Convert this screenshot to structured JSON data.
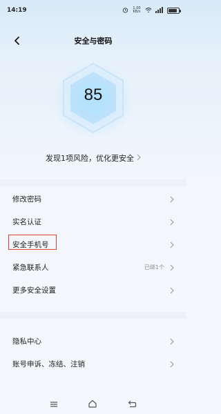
{
  "status_bar": {
    "time": "14:19",
    "speed": "1.00 KB/s",
    "battery_level": 0.85
  },
  "nav": {
    "title": "安全与密码",
    "back_icon": "chevron-left-icon"
  },
  "score": {
    "value": "85",
    "risk_text": "发现1项风险，优化更安全"
  },
  "menu_group_1": [
    {
      "label": "修改密码"
    },
    {
      "label": "实名认证"
    },
    {
      "label": "安全手机号"
    },
    {
      "label": "紧急联系人",
      "value": "已绑1个"
    },
    {
      "label": "更多安全设置"
    }
  ],
  "menu_group_2": [
    {
      "label": "隐私中心"
    },
    {
      "label": "账号申诉、冻结、注销"
    }
  ],
  "colors": {
    "accent": "#e0403a",
    "chevron": "#9aa0a8"
  }
}
